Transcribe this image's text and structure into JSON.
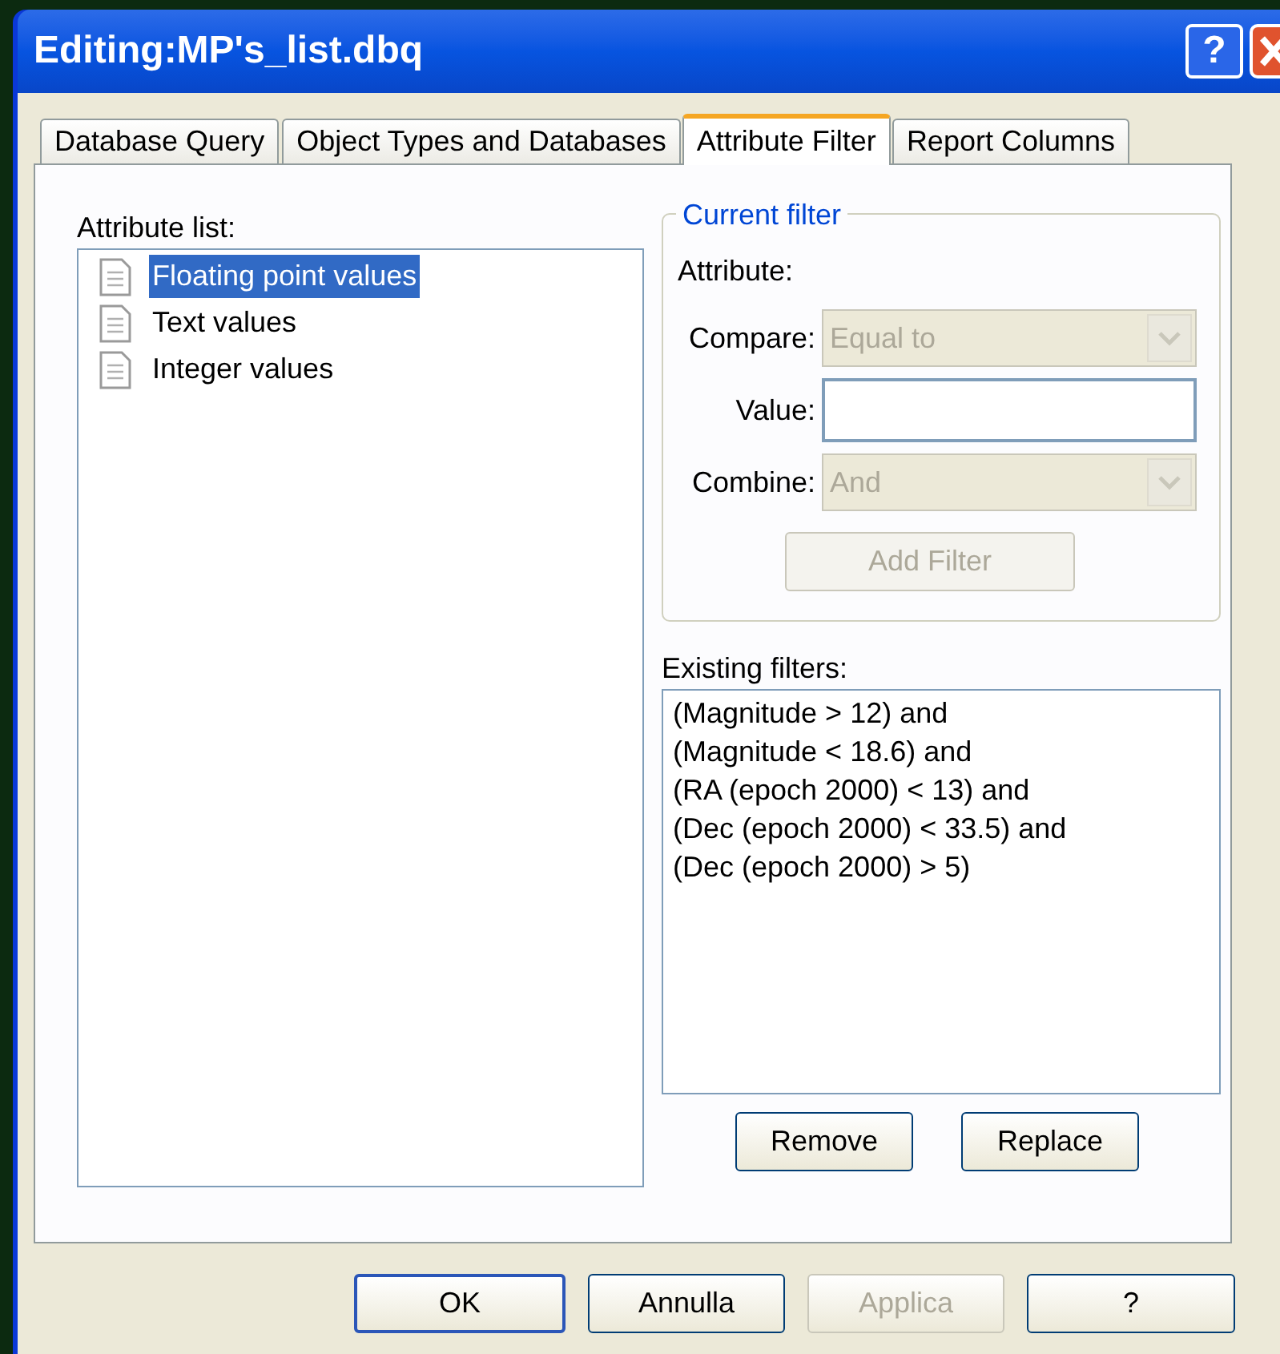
{
  "window": {
    "title": "Editing:MP's_list.dbq",
    "help_button": "?"
  },
  "tabs": [
    {
      "label": "Database Query",
      "selected": false
    },
    {
      "label": "Object Types and Databases",
      "selected": false
    },
    {
      "label": "Attribute Filter",
      "selected": true
    },
    {
      "label": "Report Columns",
      "selected": false
    }
  ],
  "attribute_list": {
    "label": "Attribute list:",
    "items": [
      {
        "label": "Floating point values",
        "selected": true
      },
      {
        "label": "Text values",
        "selected": false
      },
      {
        "label": "Integer values",
        "selected": false
      }
    ]
  },
  "current_filter": {
    "title": "Current filter",
    "attribute_label": "Attribute:",
    "compare": {
      "label": "Compare:",
      "value": "Equal to",
      "disabled": true
    },
    "value": {
      "label": "Value:"
    },
    "combine": {
      "label": "Combine:",
      "value": "And",
      "disabled": true
    },
    "add_button": {
      "label": "Add Filter",
      "disabled": true
    }
  },
  "existing_filters": {
    "label": "Existing filters:",
    "lines": [
      "(Magnitude > 12) and",
      "(Magnitude < 18.6) and",
      "(RA (epoch 2000) < 13) and",
      "(Dec (epoch 2000) < 33.5) and",
      "(Dec (epoch 2000) > 5)"
    ]
  },
  "filter_buttons": [
    {
      "label": "Remove",
      "disabled": false
    },
    {
      "label": "Replace",
      "disabled": false
    }
  ],
  "dialog_buttons": [
    {
      "label": "OK",
      "disabled": false,
      "default": true
    },
    {
      "label": "Annulla",
      "disabled": false,
      "default": false
    },
    {
      "label": "Applica",
      "disabled": true,
      "default": false
    },
    {
      "label": "?",
      "disabled": false,
      "default": false
    }
  ]
}
